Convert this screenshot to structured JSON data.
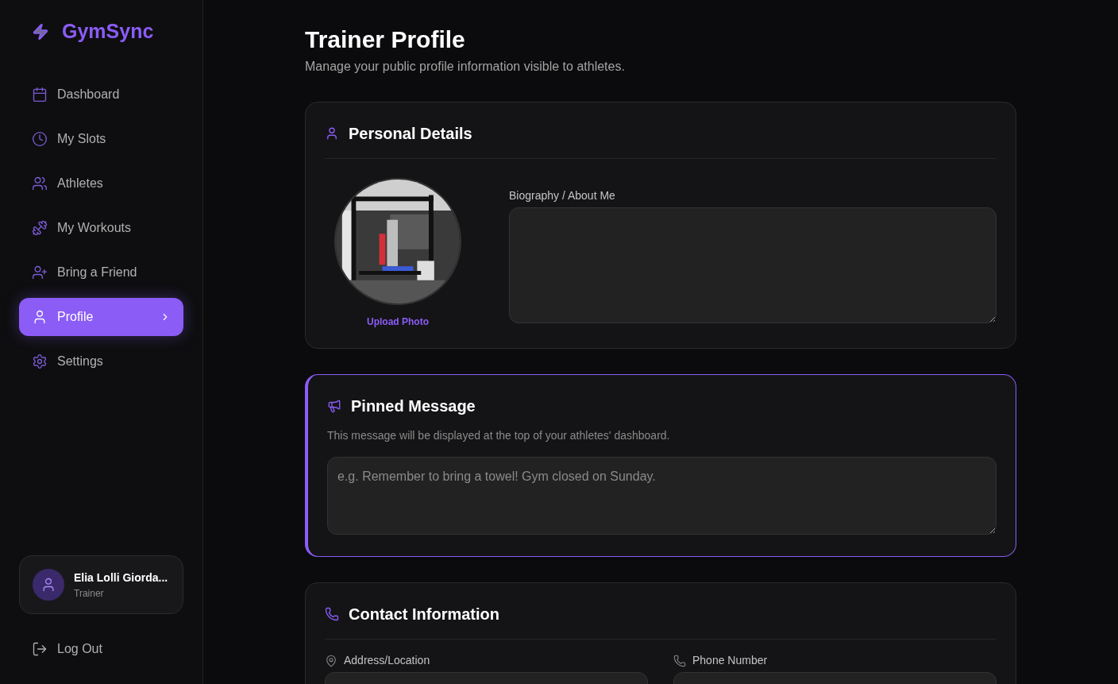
{
  "brand": "GymSync",
  "nav": [
    {
      "label": "Dashboard",
      "selected": false
    },
    {
      "label": "My Slots",
      "selected": false
    },
    {
      "label": "Athletes",
      "selected": false
    },
    {
      "label": "My Workouts",
      "selected": false
    },
    {
      "label": "Bring a Friend",
      "selected": false
    },
    {
      "label": "Profile",
      "selected": true
    },
    {
      "label": "Settings",
      "selected": false
    }
  ],
  "user": {
    "name": "Elia Lolli Giorda...",
    "role": "Trainer"
  },
  "logout": "Log Out",
  "page": {
    "title": "Trainer Profile",
    "subtitle": "Manage your public profile information visible to athletes."
  },
  "personal": {
    "title": "Personal Details",
    "upload": "Upload Photo",
    "bio_label": "Biography / About Me"
  },
  "pinned": {
    "title": "Pinned Message",
    "description": "This message will be displayed at the top of your athletes' dashboard.",
    "placeholder": "e.g. Remember to bring a towel! Gym closed on Sunday.",
    "highlighted": true
  },
  "contact": {
    "title": "Contact Information",
    "fields": [
      {
        "label": "Address/Location"
      },
      {
        "label": "Phone Number"
      }
    ]
  }
}
